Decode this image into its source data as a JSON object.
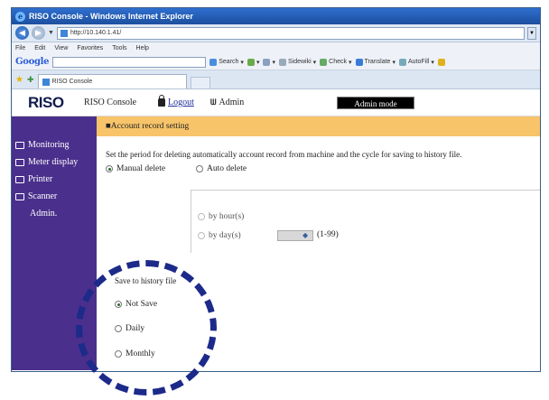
{
  "window": {
    "title": "RISO Console - Windows Internet Explorer"
  },
  "addressbar": {
    "url": "http://10.140.1.41/"
  },
  "menubar": {
    "items": [
      "File",
      "Edit",
      "View",
      "Favorites",
      "Tools",
      "Help"
    ]
  },
  "googlebar": {
    "logo": "Google",
    "search_label": "Search",
    "sidewiki_label": "Sidewiki",
    "check_label": "Check",
    "translate_label": "Translate",
    "autofill_label": "AutoFill"
  },
  "tabs": {
    "active_label": "RISO Console"
  },
  "app": {
    "logo": "RISO",
    "console_label": "RISO Console",
    "logout_label": "Logout",
    "user_label": "Admin",
    "mode_label": "Admin mode"
  },
  "sidebar": {
    "items": [
      {
        "label": "Monitoring"
      },
      {
        "label": "Meter display"
      },
      {
        "label": "Printer"
      },
      {
        "label": "Scanner"
      },
      {
        "label": "Admin."
      }
    ]
  },
  "content": {
    "section_title": "■Account record setting",
    "description": "Set the period for deleting automatically account record from machine and the cycle for saving to history file.",
    "delete_mode": {
      "manual": "Manual delete",
      "auto": "Auto delete",
      "selected": "manual"
    },
    "period": {
      "by_hour": "by hour(s)",
      "by_day": "by day(s)",
      "range": "(1-99)"
    },
    "history": {
      "label": "Save to history file",
      "not_save": "Not Save",
      "daily": "Daily",
      "monthly": "Monthly",
      "selected": "not_save"
    }
  },
  "colors": {
    "sidebar": "#4a2f8c",
    "section_header": "#f7c46a",
    "annotation": "#1c2a8a"
  }
}
